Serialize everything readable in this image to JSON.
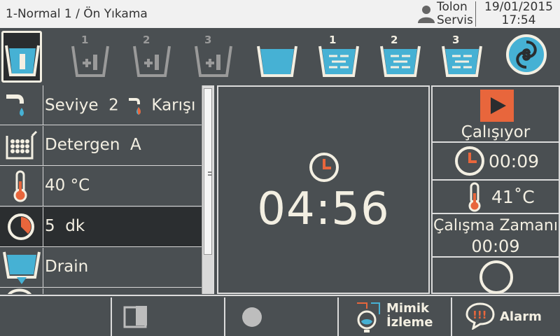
{
  "header": {
    "title": "1-Normal 1 / Ön Yıkama",
    "user_line1": "Tolon",
    "user_line2": "Servis",
    "date": "19/01/2015",
    "time": "17:54"
  },
  "steps": [
    {
      "name": "prewash",
      "number": "",
      "active": true
    },
    {
      "name": "fill-1",
      "number": "1",
      "active": false
    },
    {
      "name": "fill-2",
      "number": "2",
      "active": false
    },
    {
      "name": "fill-3",
      "number": "3",
      "active": false
    },
    {
      "name": "main-wash",
      "number": "",
      "active": false
    },
    {
      "name": "rinse-1",
      "number": "1",
      "active": false
    },
    {
      "name": "rinse-2",
      "number": "2",
      "active": false
    },
    {
      "name": "rinse-3",
      "number": "3",
      "active": false
    },
    {
      "name": "spin",
      "number": "",
      "active": false
    }
  ],
  "details": {
    "level_label": "Seviye",
    "level_value": "2",
    "water_mix": "Karışı",
    "detergent": "Detergen  A",
    "temperature": "40 °C",
    "duration": "5  dk",
    "drain": "Drain"
  },
  "center": {
    "remaining_time": "04:56"
  },
  "status": {
    "state": "Çalışıyor",
    "elapsed": "00:09",
    "current_temp": "41˚C",
    "work_time_label": "Çalışma Zamanı",
    "work_time": "00:09"
  },
  "bottom": {
    "mimic_line1": "Mimik",
    "mimic_line2": "İzleme",
    "alarm": "Alarm"
  },
  "colors": {
    "background": "#4a4f52",
    "text": "#f3efe2",
    "water": "#46b1d4",
    "accent": "#e8663c",
    "selected_row": "#2b2e30"
  }
}
